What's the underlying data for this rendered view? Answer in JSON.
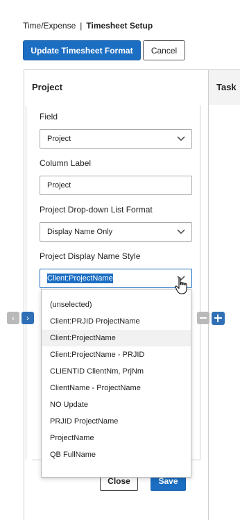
{
  "breadcrumb": {
    "parent": "Time/Expense",
    "separator": "|",
    "current": "Timesheet Setup"
  },
  "toolbar": {
    "update_label": "Update Timesheet Format",
    "cancel_label": "Cancel"
  },
  "grid": {
    "columns": [
      {
        "label": "Project"
      },
      {
        "label": "Task"
      }
    ]
  },
  "form": {
    "field_label": "Field",
    "field_value": "Project",
    "column_label_label": "Column Label",
    "column_label_value": "Project",
    "dropdown_format_label": "Project Drop-down List Format",
    "dropdown_format_value": "Display Name Only",
    "display_style_label": "Project Display Name Style",
    "display_style_value": "Client:ProjectName"
  },
  "dropdown_options": [
    "(unselected)",
    "Client:PRJID ProjectName",
    "Client:ProjectName",
    "Client:ProjectName - PRJID",
    "CLIENTID ClientNm, PrjNm",
    "ClientName - ProjectName",
    "NO Update",
    "PRJID ProjectName",
    "ProjectName",
    "QB FullName"
  ],
  "hovered_option_index": 2,
  "footer": {
    "close_label": "Close",
    "save_label": "Save"
  },
  "colors": {
    "primary": "#1b6ec2",
    "nav_blue": "#2f6fb5",
    "nav_gray": "#b9b9b9"
  },
  "icons": [
    "chevron-left-icon",
    "chevron-right-icon",
    "minus-icon",
    "plus-icon",
    "chevron-down-icon",
    "hand-cursor-icon"
  ]
}
